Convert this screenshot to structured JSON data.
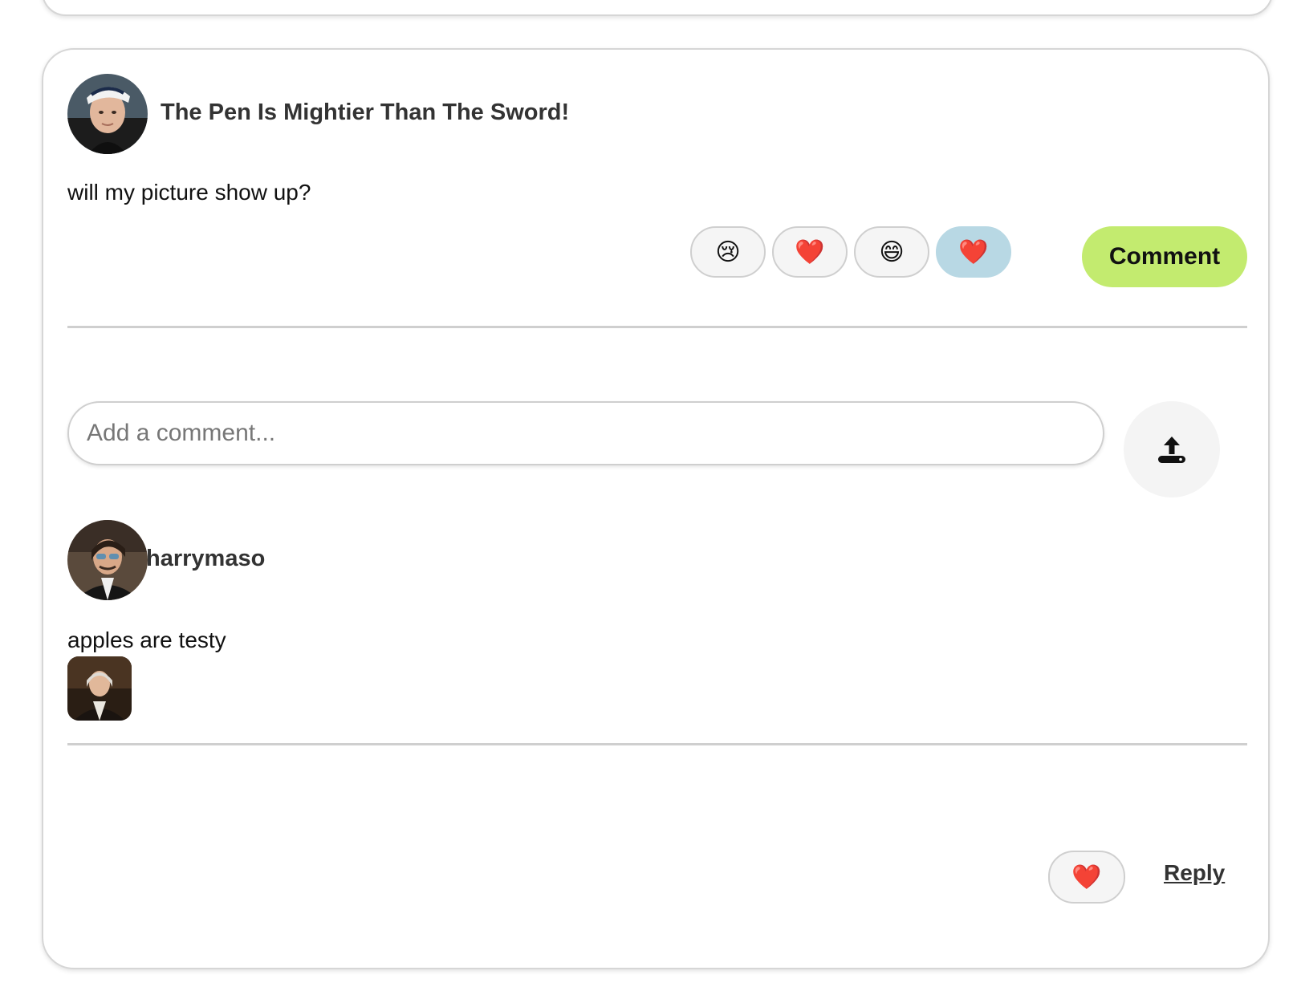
{
  "post": {
    "title": "The Pen Is Mightier Than The Sword!",
    "body": "will my picture show up?",
    "reactions": [
      {
        "emoji": "😢",
        "icon": "crying-face-icon",
        "active": false
      },
      {
        "emoji": "❤️",
        "icon": "red-heart-icon",
        "active": false
      },
      {
        "emoji": "😄",
        "icon": "grinning-face-icon",
        "active": false
      },
      {
        "emoji": "❤️",
        "icon": "red-heart-icon",
        "active": true
      }
    ],
    "comment_button_label": "Comment",
    "active_reaction_color": "#b8d8e4",
    "comment_button_color": "#c3eb6f"
  },
  "comment_form": {
    "placeholder": "Add a comment...",
    "value": "",
    "upload_icon": "upload-icon"
  },
  "comments": [
    {
      "author": "harrymaso",
      "text": "apples are testy",
      "like_emoji": "❤️",
      "reply_label": "Reply"
    }
  ]
}
